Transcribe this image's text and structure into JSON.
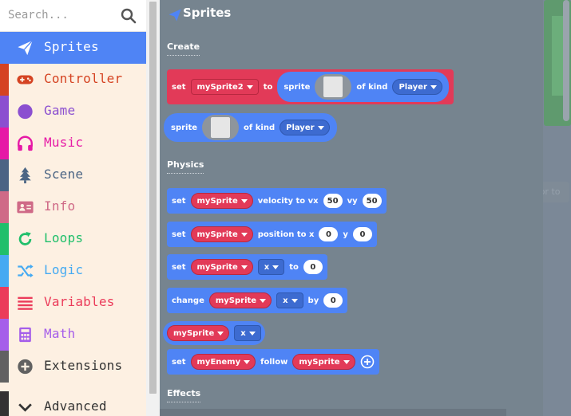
{
  "search": {
    "placeholder": "Search..."
  },
  "categories": [
    {
      "label": "Sprites",
      "color": "#4f84f5",
      "icon": "paper-plane-icon",
      "selected": true
    },
    {
      "label": "Controller",
      "color": "#d54322",
      "icon": "gamepad-icon"
    },
    {
      "label": "Game",
      "color": "#8b4fd0",
      "icon": "circle-icon"
    },
    {
      "label": "Music",
      "color": "#e619a6",
      "icon": "headphones-icon"
    },
    {
      "label": "Scene",
      "color": "#4b6584",
      "icon": "tree-icon"
    },
    {
      "label": "Info",
      "color": "#cf6a87",
      "icon": "id-card-icon"
    },
    {
      "label": "Loops",
      "color": "#20bf6b",
      "icon": "refresh-icon"
    },
    {
      "label": "Logic",
      "color": "#45aaf2",
      "icon": "shuffle-icon"
    },
    {
      "label": "Variables",
      "color": "#eb3b5a",
      "icon": "list-icon"
    },
    {
      "label": "Math",
      "color": "#a55eea",
      "icon": "calculator-icon"
    },
    {
      "label": "Extensions",
      "color": "#616161",
      "icon": "plus-circle-icon"
    },
    {
      "label": "Advanced",
      "color": "#333333",
      "icon": "chevron-down-icon"
    }
  ],
  "flyout": {
    "title": "Sprites",
    "sections": {
      "create": "Create",
      "physics": "Physics",
      "effects": "Effects"
    },
    "blocks": {
      "set_sprite": {
        "set": "set",
        "var": "mySprite2",
        "to": "to",
        "sprite": "sprite",
        "of_kind": "of kind",
        "kind": "Player"
      },
      "sprite_reporter": {
        "sprite": "sprite",
        "of_kind": "of kind",
        "kind": "Player"
      },
      "velocity": {
        "set": "set",
        "var": "mySprite",
        "label": "velocity to vx",
        "vx": "50",
        "vy_label": "vy",
        "vy": "50"
      },
      "position": {
        "set": "set",
        "var": "mySprite",
        "label": "position to x",
        "x": "0",
        "y_label": "y",
        "y": "0"
      },
      "set_prop": {
        "set": "set",
        "var": "mySprite",
        "prop": "x",
        "to": "to",
        "value": "0"
      },
      "change_prop": {
        "change": "change",
        "var": "mySprite",
        "prop": "x",
        "by": "by",
        "value": "0"
      },
      "prop_reporter": {
        "var": "mySprite",
        "prop": "x"
      },
      "follow": {
        "set": "set",
        "var": "myEnemy",
        "label": "follow",
        "target": "mySprite"
      }
    }
  },
  "workspace": {
    "ghost_block": "set background color to"
  }
}
